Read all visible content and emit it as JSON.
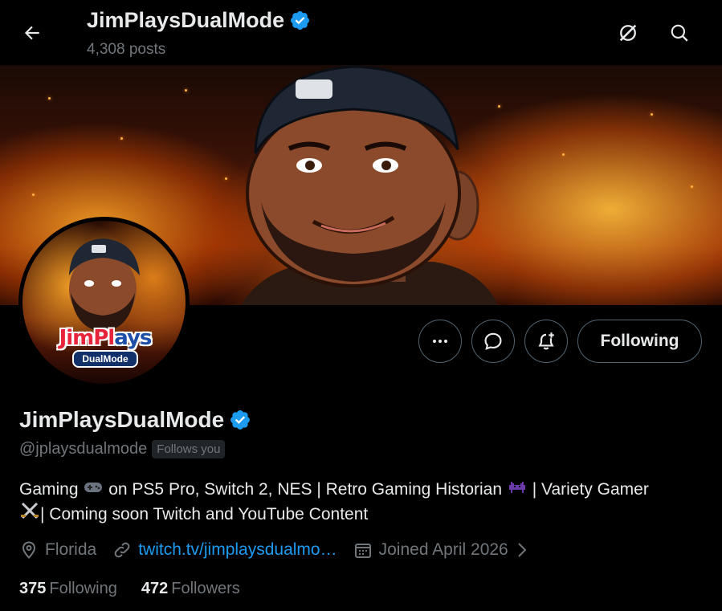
{
  "header": {
    "title": "JimPlaysDualMode",
    "posts_count": "4,308 posts"
  },
  "banner": {
    "description": "cartoon man in cap with fiery explosion background"
  },
  "avatar": {
    "logo_text_red": "JimPl",
    "logo_text_blue": "ays",
    "logo_sub": "DualMode"
  },
  "actions": {
    "follow_label": "Following"
  },
  "profile": {
    "name": "JimPlaysDualMode",
    "handle": "@jplaysdualmode",
    "follows_you": "Follows you",
    "bio_part1": "Gaming",
    "bio_part2": "on PS5 Pro, Switch 2, NES | Retro Gaming Historian",
    "bio_part3": "| Variety Gamer",
    "bio_part4": "| Coming soon Twitch and YouTube Content",
    "location": "Florida",
    "link": "twitch.tv/jimplaysdualmo…",
    "joined": "Joined April 2026"
  },
  "stats": {
    "following_count": "375",
    "following_label": "Following",
    "followers_count": "472",
    "followers_label": "Followers"
  },
  "colors": {
    "background": "#000000",
    "text": "#e7e9ea",
    "muted": "#71767b",
    "accent": "#1d9bf0",
    "border": "#536471"
  }
}
